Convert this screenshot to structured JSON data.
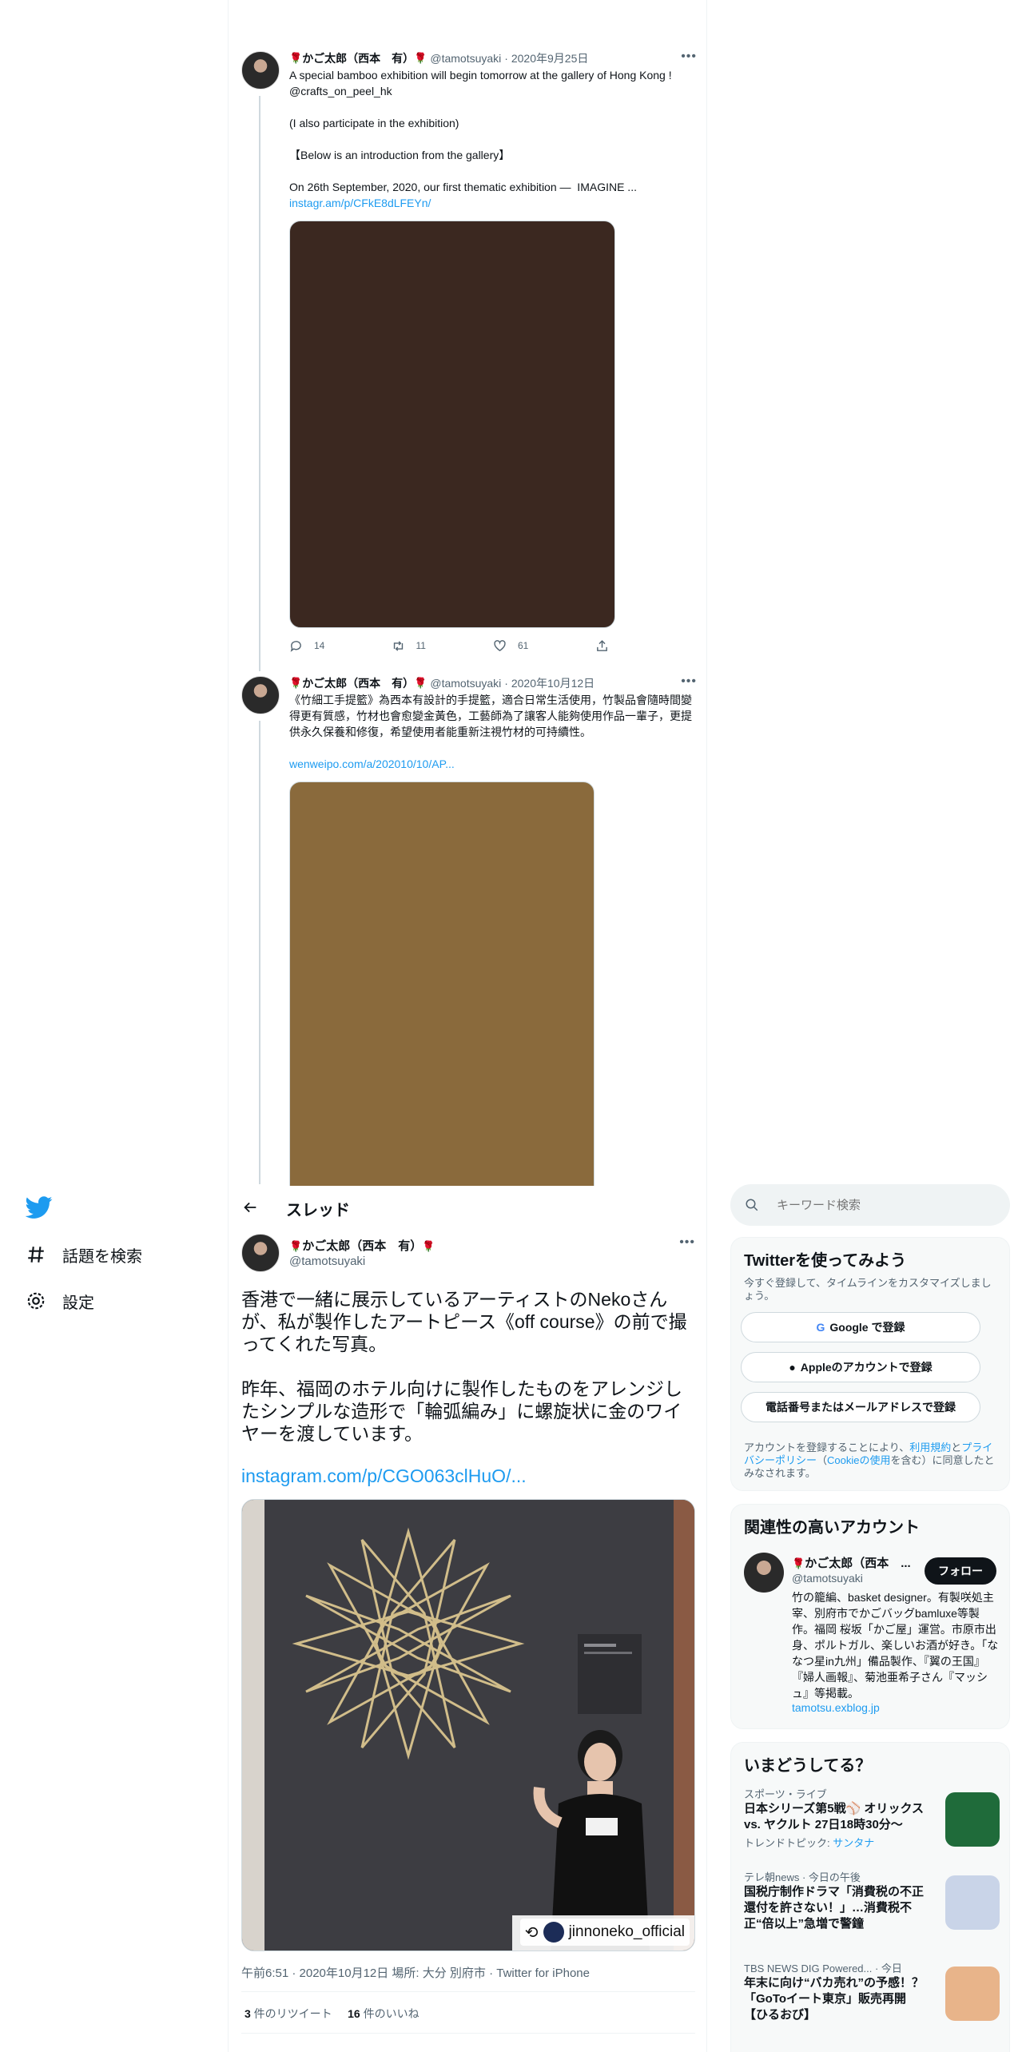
{
  "nav": {
    "logo": "twitter-bird-icon",
    "items": [
      {
        "label": "話題を検索",
        "icon": "hashtag-icon"
      },
      {
        "label": "設定",
        "icon": "gear-icon"
      }
    ]
  },
  "tweets": [
    {
      "name": "かご太郎（西本　有）",
      "handle": "@tamotsuyaki",
      "date": "· 2020年9月25日",
      "text": "A special bamboo exhibition will begin tomorrow at the gallery of Hong Kong ! @crafts_on_peel_hk\n\n(I also participate in the exhibition)\n\n【Below is an introduction from the gallery】\n\nOn 26th September, 2020, our first thematic exhibition —  IMAGINE ...",
      "link": "instagr.am/p/CFkE8dLFEYn/",
      "media_color": "#3b2820",
      "replies": "14",
      "retweets": "11",
      "likes": "61"
    },
    {
      "name": "かご太郎（西本　有）",
      "handle": "@tamotsuyaki",
      "date": "· 2020年10月12日",
      "text": "《竹細工手提籃》為西本有設計的手提籃，適合日常生活使用，竹製品會隨時間變得更有質感，竹材也會愈變金黃色，工藝師為了讓客人能夠使用作品一輩子，更提供永久保養和修復，希望使用者能重新注視竹材的可持續性。",
      "link": "wenweipo.com/a/202010/10/AP...",
      "media_color": "#8a6a3c"
    }
  ],
  "header": {
    "title": "スレッド"
  },
  "focus": {
    "name": "かご太郎（西本　有）",
    "handle": "@tamotsuyaki",
    "text": "香港で一緒に展示しているアーティストのNekoさんが、私が製作したアートピース《off course》の前で撮ってくれた写真。\n\n昨年、福岡のホテル向けに製作したものをアレンジしたシンプルな造形で「輪弧編み」に螺旋状に金のワイヤーを渡しています。",
    "link": "instagram.com/p/CGO063clHuO/...",
    "photo_caption": "jinnoneko_official",
    "meta": "午前6:51 · 2020年10月12日 場所: 大分 別府市 · Twitter for iPhone",
    "retweet_count": "3",
    "retweet_label": " 件のリツイート",
    "like_count": "16",
    "like_label": " 件のいいね"
  },
  "sidebar": {
    "search_placeholder": "キーワード検索",
    "signup": {
      "title": "Twitterを使ってみよう",
      "subtitle": "今すぐ登録して、タイムラインをカスタマイズしましょう。",
      "google": "Google で登録",
      "apple": "Appleのアカウントで登録",
      "phone": "電話番号またはメールアドレスで登録",
      "legal_pre": "アカウントを登録することにより、",
      "legal_terms": "利用規約",
      "legal_and": "と",
      "legal_privacy": "プライバシーポリシー",
      "legal_mid": "（",
      "legal_cookie": "Cookieの使用",
      "legal_post": "を含む）に同意したとみなされます。"
    },
    "related": {
      "title": "関連性の高いアカウント",
      "name": "かご太郎（西本　...",
      "handle": "@tamotsuyaki",
      "follow": "フォロー",
      "bio": "竹の籠編、basket designer。有製咲処主宰、別府市でかごバッグbamluxe等製作。福岡 桜坂「かご屋」運営。市原市出身、ポルトガル、楽しいお酒が好き。「ななつ星in九州」備品製作、『翼の王国』『婦人画報』、菊池亜希子さん『マッシュ』等掲載。",
      "url": "tamotsu.exblog.jp"
    },
    "trends": {
      "title": "いまどうしてる？",
      "items": [
        {
          "category": "スポーツ・ライブ",
          "title": "日本シリーズ第5戦⚾ オリックス vs. ヤクルト 27日18時30分〜",
          "sub_pre": "トレンドトピック: ",
          "sub_link": "サンタナ",
          "thumb": "#1f6b3a"
        },
        {
          "category": "テレ朝news · 今日の午後",
          "title": "国税庁制作ドラマ「消費税の不正還付を許さない！」…消費税不正“倍以上”急増で警鐘",
          "thumb": "#c9d4e8"
        },
        {
          "category": "TBS NEWS DIG Powered... · 今日",
          "title": "年末に向け“バカ売れ”の予感！？「GoToイート東京」販売再開【ひるおび】",
          "thumb": "#e8b48a"
        }
      ]
    }
  }
}
